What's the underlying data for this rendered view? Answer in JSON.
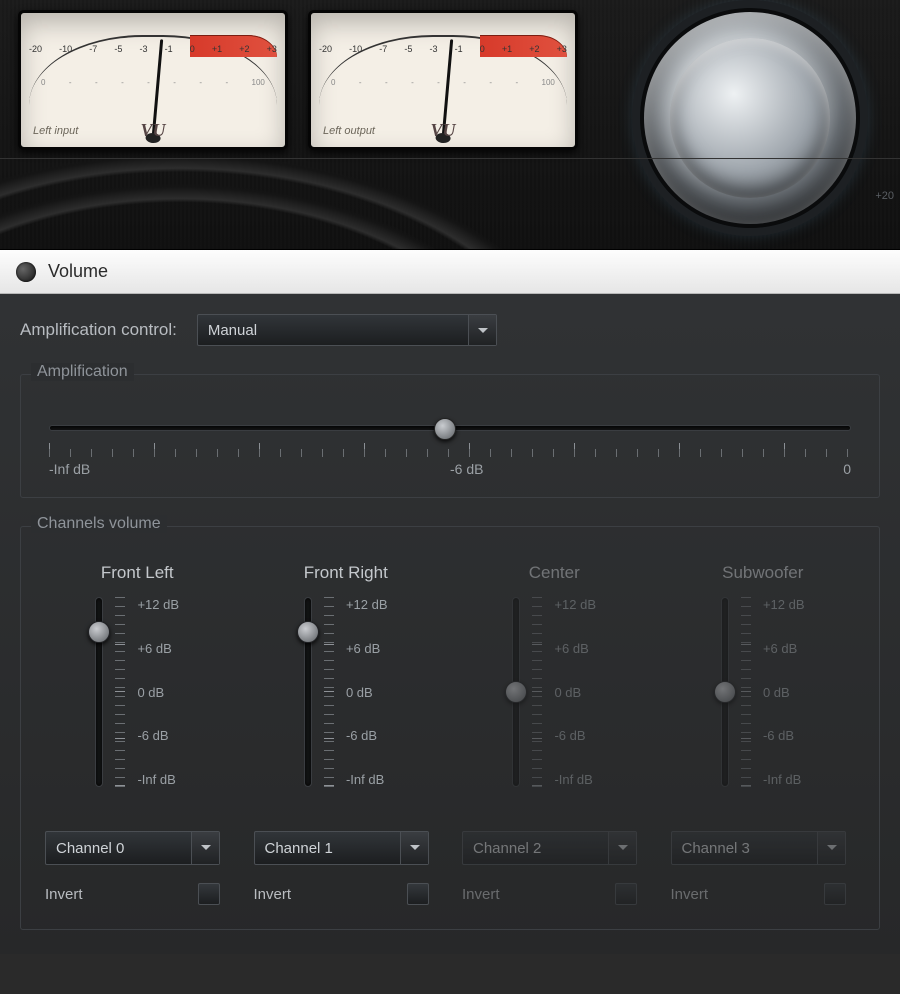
{
  "section": {
    "title": "Volume"
  },
  "vu_meters": {
    "left": {
      "caption": "Left input",
      "label": "VU",
      "scale_top": [
        "-20",
        "-10",
        "-7",
        "-5",
        "-3",
        "-1",
        "0",
        "+1",
        "+2",
        "+3"
      ],
      "scale_bot": [
        "0",
        "-",
        "-",
        "-",
        "-",
        "-",
        "-",
        "-",
        "100"
      ]
    },
    "right": {
      "caption": "Left output",
      "label": "VU",
      "scale_top": [
        "-20",
        "-10",
        "-7",
        "-5",
        "-3",
        "-1",
        "0",
        "+1",
        "+2",
        "+3"
      ],
      "scale_bot": [
        "0",
        "-",
        "-",
        "-",
        "-",
        "-",
        "-",
        "-",
        "100"
      ]
    }
  },
  "knob": {
    "max_label": "+20"
  },
  "amp_control": {
    "label": "Amplification control:",
    "value": "Manual"
  },
  "amplification": {
    "group_label": "Amplification",
    "ticks": {
      "min": "-Inf dB",
      "mid": "-6 dB",
      "max": "0"
    },
    "position_pct": 48
  },
  "channels_group": {
    "label": "Channels volume"
  },
  "slider_labels": [
    "+12 dB",
    "+6 dB",
    "0 dB",
    "-6 dB",
    "-Inf dB"
  ],
  "channels": [
    {
      "name": "Front Left",
      "enabled": true,
      "thumb_pct": 18,
      "select": "Channel 0",
      "invert_label": "Invert",
      "invert": false
    },
    {
      "name": "Front Right",
      "enabled": true,
      "thumb_pct": 18,
      "select": "Channel 1",
      "invert_label": "Invert",
      "invert": false
    },
    {
      "name": "Center",
      "enabled": false,
      "thumb_pct": 50,
      "select": "Channel 2",
      "invert_label": "Invert",
      "invert": false
    },
    {
      "name": "Subwoofer",
      "enabled": false,
      "thumb_pct": 50,
      "select": "Channel 3",
      "invert_label": "Invert",
      "invert": false
    }
  ]
}
